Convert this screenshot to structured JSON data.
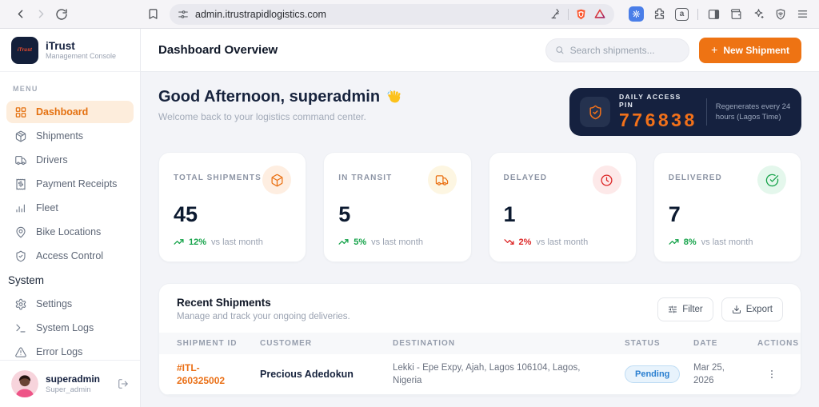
{
  "browser": {
    "url": "admin.itrustrapidlogistics.com",
    "search_engine_letter": "a"
  },
  "sidebar": {
    "brand": {
      "title": "iTrust",
      "subtitle": "Management Console",
      "logo_text": "iTrust"
    },
    "menu_label": "MENU",
    "menu_items": [
      "Dashboard",
      "Shipments",
      "Drivers",
      "Payment Receipts",
      "Fleet",
      "Bike Locations",
      "Access Control"
    ],
    "system_label": "System",
    "system_items": [
      "Settings",
      "System Logs",
      "Error Logs"
    ],
    "user": {
      "name": "superadmin",
      "role": "Super_admin"
    }
  },
  "header": {
    "title": "Dashboard Overview",
    "search_placeholder": "Search shipments...",
    "new_shipment_plus": "+",
    "new_shipment_label": "New Shipment"
  },
  "greeting": {
    "title": "Good Afternoon, superadmin",
    "emoji": "👋",
    "subtitle": "Welcome back to your logistics command center."
  },
  "pin_card": {
    "label": "DAILY ACCESS PIN",
    "pin": "776838",
    "note": "Regenerates every 24 hours (Lagos Time)"
  },
  "stats": [
    {
      "label": "TOTAL SHIPMENTS",
      "value": "45",
      "trend": "12%",
      "direction": "up",
      "note": "vs last month",
      "icon": "package"
    },
    {
      "label": "IN TRANSIT",
      "value": "5",
      "trend": "5%",
      "direction": "up",
      "note": "vs last month",
      "icon": "truck"
    },
    {
      "label": "DELAYED",
      "value": "1",
      "trend": "2%",
      "direction": "down",
      "note": "vs last month",
      "icon": "clock"
    },
    {
      "label": "DELIVERED",
      "value": "7",
      "trend": "8%",
      "direction": "up",
      "note": "vs last month",
      "icon": "check-circle"
    }
  ],
  "shipments": {
    "title": "Recent Shipments",
    "subtitle": "Manage and track your ongoing deliveries.",
    "filter_label": "Filter",
    "export_label": "Export",
    "columns": [
      "SHIPMENT ID",
      "CUSTOMER",
      "DESTINATION",
      "STATUS",
      "DATE",
      "ACTIONS"
    ],
    "rows": [
      {
        "id": "#ITL-260325002",
        "customer": "Precious Adedokun",
        "destination": "Lekki - Epe Expy, Ajah, Lagos 106104, Lagos, Nigeria",
        "status": "Pending",
        "date": "Mar 25, 2026"
      }
    ]
  },
  "colors": {
    "accent_orange": "#ee7313",
    "navy": "#15213f",
    "trend_green": "#16a34a",
    "trend_red": "#dc2626",
    "badge_blue": "#2a7fd0",
    "active_item_bg": "#fdeddc"
  }
}
